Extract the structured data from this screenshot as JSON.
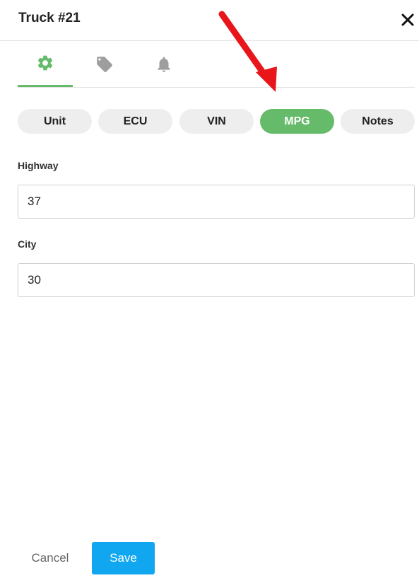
{
  "header": {
    "title": "Truck #21",
    "close_icon": "close-icon"
  },
  "icon_tabs": [
    {
      "name": "gear-icon",
      "active": true,
      "color": "#66bb6a"
    },
    {
      "name": "tag-icon",
      "active": false,
      "color": "#9e9e9e"
    },
    {
      "name": "bell-icon",
      "active": false,
      "color": "#9e9e9e"
    }
  ],
  "pills": [
    {
      "label": "Unit",
      "active": false
    },
    {
      "label": "ECU",
      "active": false
    },
    {
      "label": "VIN",
      "active": false
    },
    {
      "label": "MPG",
      "active": true
    },
    {
      "label": "Notes",
      "active": false
    }
  ],
  "form": {
    "highway": {
      "label": "Highway",
      "value": "37"
    },
    "city": {
      "label": "City",
      "value": "30"
    }
  },
  "footer": {
    "cancel_label": "Cancel",
    "save_label": "Save"
  },
  "colors": {
    "accent": "#66bb6a",
    "primary": "#10a7f0",
    "annotation_arrow": "#e8161b"
  }
}
